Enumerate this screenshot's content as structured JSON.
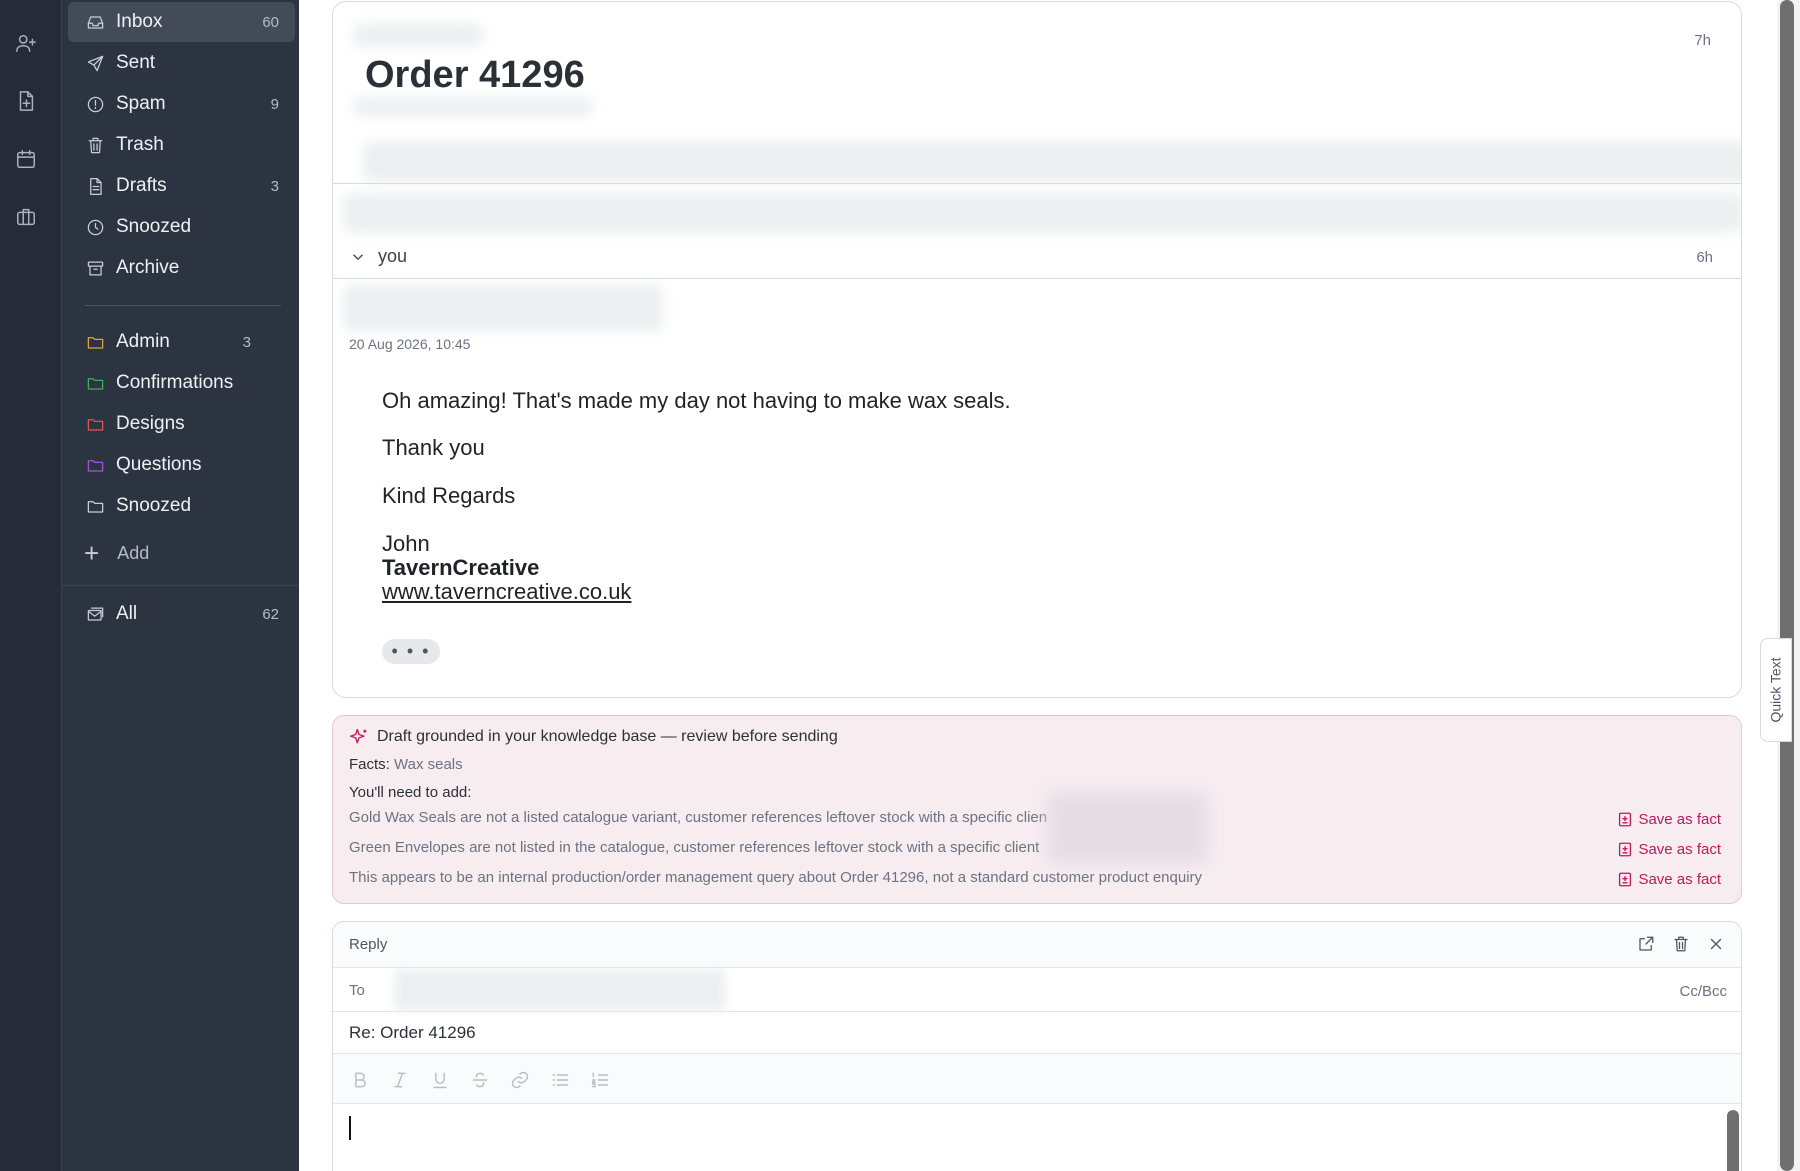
{
  "rail": {
    "icons": [
      "add-contact-icon",
      "document-add-icon",
      "calendar-icon",
      "briefcase-icon"
    ]
  },
  "sidebar": {
    "system": [
      {
        "label": "Inbox",
        "count": "60",
        "icon": "inbox-icon",
        "active": true
      },
      {
        "label": "Sent",
        "count": "",
        "icon": "send-icon"
      },
      {
        "label": "Spam",
        "count": "9",
        "icon": "alert-circle-icon"
      },
      {
        "label": "Trash",
        "count": "",
        "icon": "trash-icon"
      },
      {
        "label": "Drafts",
        "count": "3",
        "icon": "draft-icon"
      },
      {
        "label": "Snoozed",
        "count": "",
        "icon": "clock-icon"
      },
      {
        "label": "Archive",
        "count": "",
        "icon": "archive-icon"
      }
    ],
    "folders": [
      {
        "label": "Admin",
        "count": "3",
        "color": "#e0a53a"
      },
      {
        "label": "Confirmations",
        "count": "",
        "color": "#3fae5a"
      },
      {
        "label": "Designs",
        "count": "",
        "color": "#e05555"
      },
      {
        "label": "Questions",
        "count": "",
        "color": "#9b59d6"
      },
      {
        "label": "Snoozed",
        "count": "",
        "color": "#c9ced6"
      }
    ],
    "add_label": "Add",
    "all": {
      "label": "All",
      "count": "62"
    }
  },
  "thread": {
    "subject": "Order 41296",
    "first_time": "7h",
    "sender": "you",
    "second_time": "6h",
    "date": "20 Aug 2026, 10:45",
    "body": {
      "line1": "Oh amazing! That's made my day not having to make wax seals.",
      "line2": "Thank you",
      "line3": "Kind Regards",
      "name": "John",
      "company": "TavernCreative",
      "website": "www.taverncreative.co.uk"
    },
    "more_label": "• • •"
  },
  "kb": {
    "heading": "Draft grounded in your knowledge base — review before sending",
    "facts_label": "Facts:",
    "facts_value": "Wax seals",
    "need_label": "You'll need to add:",
    "items": [
      "Gold Wax Seals are not a listed catalogue variant, customer references leftover stock with a specific clien",
      "Green Envelopes are not listed in the catalogue, customer references leftover stock with a specific client",
      "This appears to be an internal production/order management query about Order 41296, not a standard customer product enquiry"
    ],
    "save_label": "Save as fact",
    "accent": "#c2185b"
  },
  "reply": {
    "label": "Reply",
    "to_label": "To",
    "ccbcc": "Cc/Bcc",
    "subject": "Re: Order 41296",
    "toolbar": [
      "bold-icon",
      "italic-icon",
      "underline-icon",
      "strikethrough-icon",
      "link-icon",
      "bullet-list-icon",
      "numbered-list-icon"
    ]
  },
  "quick_text": "Quick Text"
}
